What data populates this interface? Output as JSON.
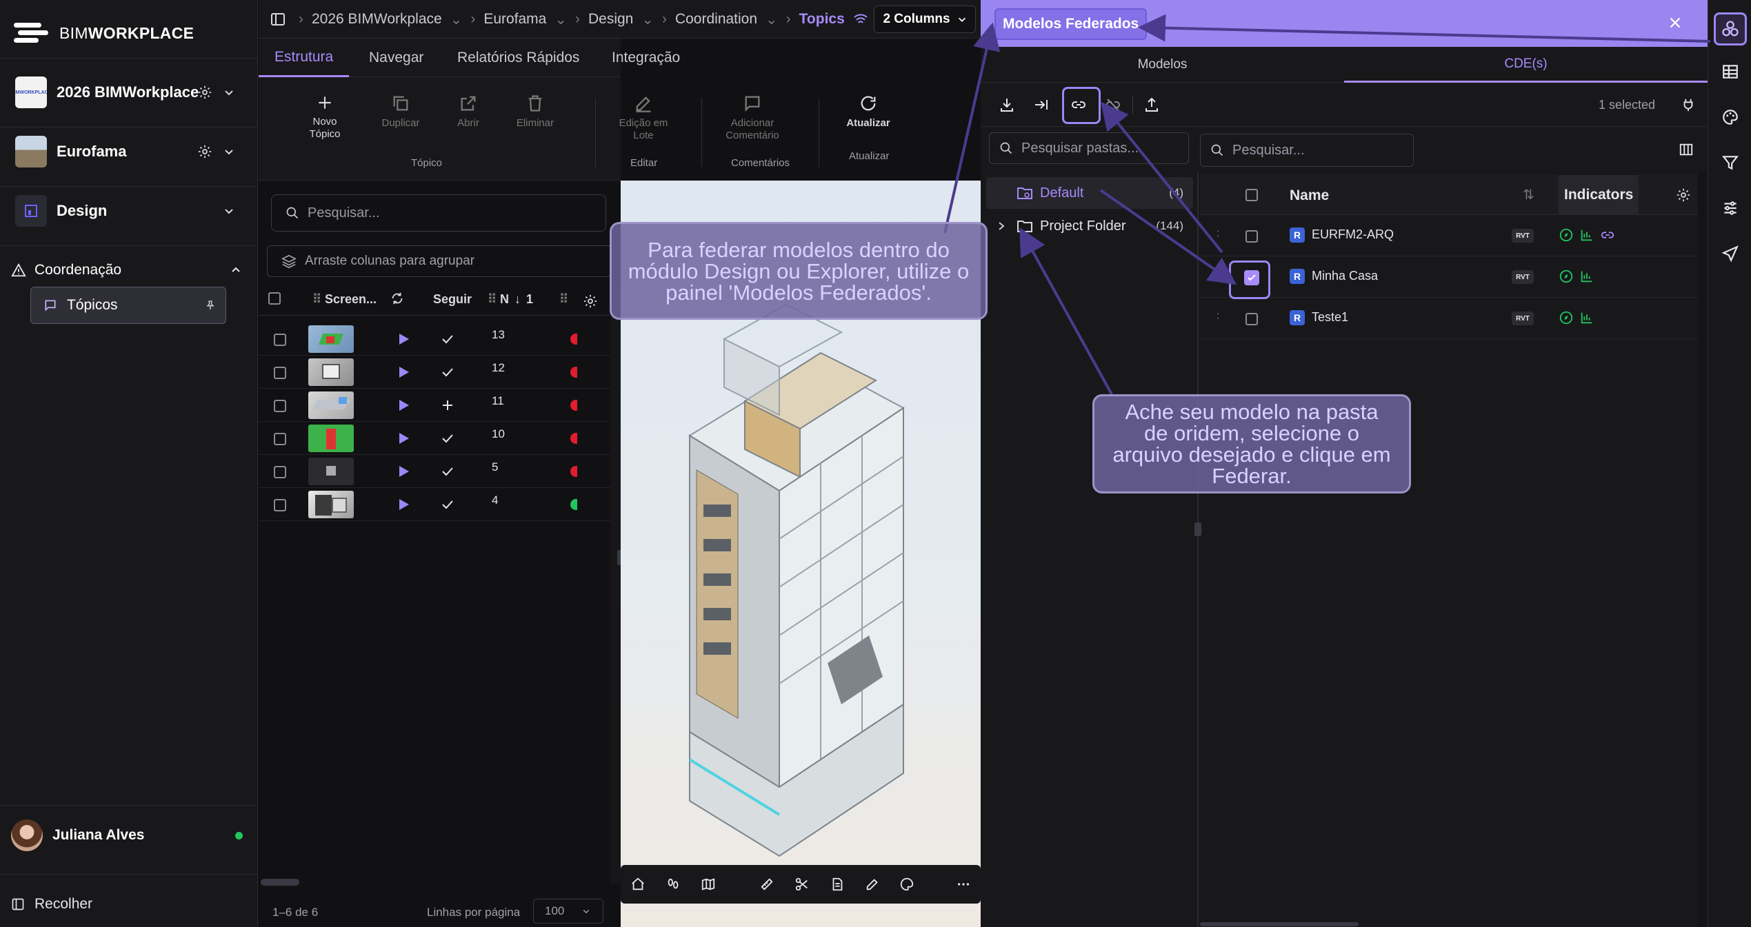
{
  "sidebar": {
    "logo": {
      "light": "BIM",
      "bold": "WORKPLACE"
    },
    "projects": [
      {
        "name": "2026 BIMWorkplace"
      },
      {
        "name": "Eurofama"
      },
      {
        "name": "Design"
      }
    ],
    "section": "Coordenação",
    "active_item": "Tópicos",
    "user": "Juliana Alves",
    "collapse": "Recolher"
  },
  "breadcrumb": [
    "2026 BIMWorkplace",
    "Eurofama",
    "Design",
    "Coordination",
    "Topics"
  ],
  "columns_selector": "2 Columns",
  "tabs": [
    "Estrutura",
    "Navegar",
    "Relatórios Rápidos",
    "Integração"
  ],
  "ribbon": {
    "topico": {
      "new": "Novo Tópico",
      "duplicate": "Duplicar",
      "open": "Abrir",
      "delete": "Eliminar",
      "group": "Tópico"
    },
    "editar": {
      "batch": "Edição em Lote",
      "group": "Editar"
    },
    "comentarios": {
      "add": "Adicionar Comentário",
      "group": "Comentários"
    },
    "atualizar": {
      "refresh": "Atualizar",
      "group": "Atualizar"
    }
  },
  "topics": {
    "search_placeholder": "Pesquisar...",
    "group_hint": "Arraste colunas para agrupar",
    "columns": {
      "screenshot": "Screen...",
      "follow": "Seguir",
      "number": "N",
      "sort": "1"
    },
    "rows": [
      {
        "n": "13",
        "status": "#e11d2e",
        "follow": "check"
      },
      {
        "n": "12",
        "status": "#e11d2e",
        "follow": "check"
      },
      {
        "n": "11",
        "status": "#e11d2e",
        "follow": "plus"
      },
      {
        "n": "10",
        "status": "#e11d2e",
        "follow": "check"
      },
      {
        "n": "5",
        "status": "#e11d2e",
        "follow": "check"
      },
      {
        "n": "4",
        "status": "#22c55e",
        "follow": "check"
      }
    ],
    "footer": {
      "range": "1–6 de 6",
      "rows_label": "Linhas por página",
      "rows_value": "100"
    }
  },
  "federated": {
    "title": "Modelos Federados",
    "tabs": [
      "Modelos",
      "CDE(s)"
    ],
    "selected_count": "1 selected",
    "folder_search_placeholder": "Pesquisar pastas...",
    "file_search_placeholder": "Pesquisar...",
    "folders": [
      {
        "name": "Default",
        "count": "(4)"
      },
      {
        "name": "Project Folder",
        "count": "(144)"
      }
    ],
    "columns": {
      "name": "Name",
      "indicators": "Indicators"
    },
    "models": [
      {
        "name": "EURFM2-ARQ",
        "type": "RVT",
        "checked": false,
        "link": true
      },
      {
        "name": "Minha Casa",
        "type": "RVT",
        "checked": true,
        "link": false
      },
      {
        "name": "Teste1",
        "type": "RVT",
        "checked": false,
        "link": false
      }
    ]
  },
  "callouts": {
    "left": "Para federar modelos dentro do módulo Design ou Explorer, utilize o painel 'Modelos Federados'.",
    "right": "Ache seu modelo na pasta de oridem, selecione o arquivo desejado e clique em Federar."
  },
  "colors": {
    "accent": "#a78bfa",
    "header": "#9a86f0",
    "bg": "#111113"
  }
}
